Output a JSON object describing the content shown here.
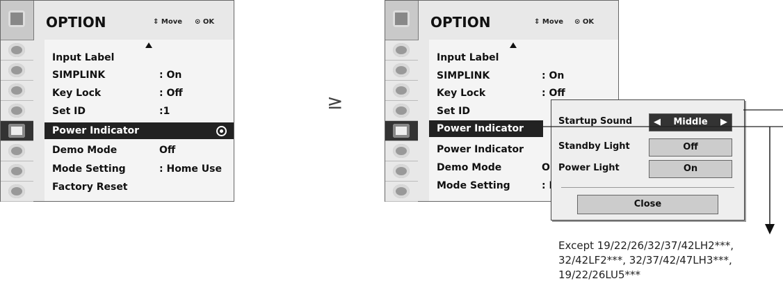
{
  "left_menu": {
    "title": "OPTION",
    "hint_move": "Move",
    "hint_ok": "OK",
    "rows": [
      {
        "label": "Input Label",
        "value": ""
      },
      {
        "label": "SIMPLINK",
        "value": ": On"
      },
      {
        "label": "Key Lock",
        "value": ": Off"
      },
      {
        "label": "Set ID",
        "value": ":1"
      },
      {
        "label": "Power Indicator",
        "value": ""
      },
      {
        "label": "Demo Mode",
        "value": "Off"
      },
      {
        "label": "Mode Setting",
        "value": ": Home Use"
      },
      {
        "label": "Factory Reset",
        "value": ""
      }
    ]
  },
  "right_menu": {
    "title": "OPTION",
    "hint_move": "Move",
    "hint_ok": "OK",
    "rows": [
      {
        "label": "Input Label",
        "value": ""
      },
      {
        "label": "SIMPLINK",
        "value": ": On"
      },
      {
        "label": "Key Lock",
        "value": ": Off"
      },
      {
        "label": "Set ID",
        "value": ""
      },
      {
        "label": "Power Indicator",
        "value": ""
      },
      {
        "label": "Power Indicator",
        "value": ""
      },
      {
        "label": "Demo Mode",
        "value": "O"
      },
      {
        "label": "Mode Setting",
        "value": ": I"
      }
    ]
  },
  "transition_glyph": "≥",
  "popup": {
    "startup_sound_label": "Startup Sound",
    "startup_sound_value": "Middle",
    "standby_light_label": "Standby Light",
    "standby_light_value": "Off",
    "power_light_label": "Power Light",
    "power_light_value": "On",
    "close_label": "Close"
  },
  "note": {
    "line1": "Except 19/22/26/32/37/42LH2***,",
    "line2": "32/42LF2***, 32/37/42/47LH3***,",
    "line3": "19/22/26LU5***"
  }
}
